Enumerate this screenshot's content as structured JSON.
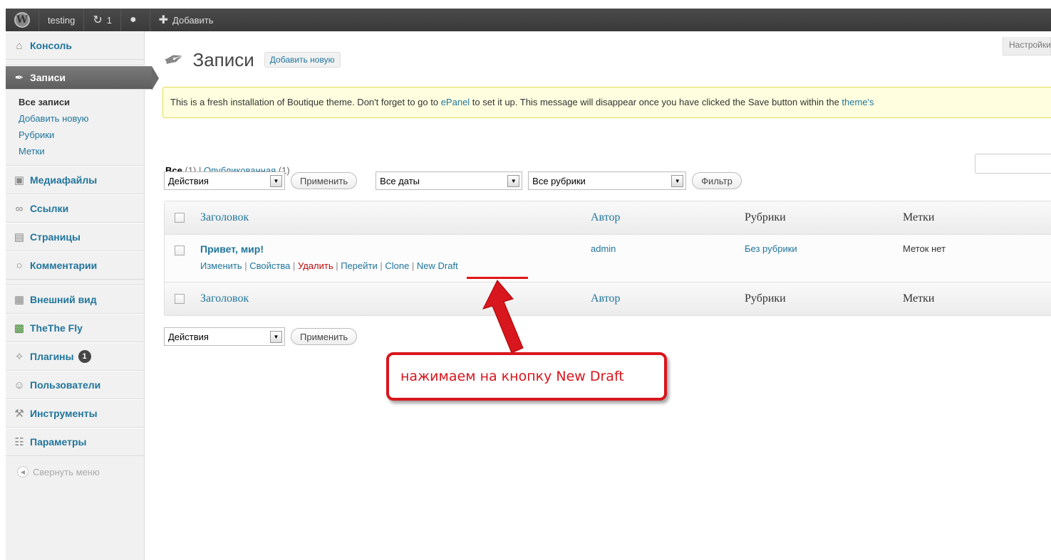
{
  "adminbar": {
    "logo": "W",
    "site": "testing",
    "updates_icon": "refresh-icon",
    "updates_count": "1",
    "comments_icon": "comment-bubble-icon",
    "add_icon": "plus-icon",
    "add_label": "Добавить"
  },
  "sidebar": {
    "items": [
      {
        "icon": "home-icon",
        "label": "Консоль"
      },
      {
        "icon": "pin-icon",
        "label": "Записи"
      },
      {
        "icon": "media-icon",
        "label": "Медиафайлы"
      },
      {
        "icon": "links-icon",
        "label": "Ссылки"
      },
      {
        "icon": "pages-icon",
        "label": "Страницы"
      },
      {
        "icon": "comments-icon",
        "label": "Комментарии"
      },
      {
        "icon": "appearance-icon",
        "label": "Внешний вид"
      },
      {
        "icon": "thethe-fly-icon",
        "label": "TheThe Fly"
      },
      {
        "icon": "plugins-icon",
        "label": "Плагины",
        "badge": "1"
      },
      {
        "icon": "users-icon",
        "label": "Пользователи"
      },
      {
        "icon": "tools-icon",
        "label": "Инструменты"
      },
      {
        "icon": "settings-icon",
        "label": "Параметры"
      }
    ],
    "submenu": [
      "Все записи",
      "Добавить новую",
      "Рубрики",
      "Метки"
    ],
    "collapse_label": "Свернуть меню"
  },
  "screen_options": "Настройки экрана",
  "page": {
    "title": "Записи",
    "add_new": "Добавить новую"
  },
  "notice": {
    "text_before": "This is a fresh installation of Boutique theme. Don't forget to go to ",
    "link": "ePanel",
    "text_after": " to set it up. This message will disappear once you have clicked the Save button within the ",
    "link2": "theme's"
  },
  "filters": {
    "all_label": "Все",
    "all_count": "(1)",
    "sep": "|",
    "published_label": "Опубликованная",
    "published_count": "(1)"
  },
  "tablenav_top": {
    "bulk_action": "Действия",
    "apply": "Применить",
    "dates": "Все даты",
    "cats": "Все рубрики",
    "filter": "Фильтр"
  },
  "table": {
    "columns": {
      "title": "Заголовок",
      "author": "Автор",
      "categories": "Рубрики",
      "tags": "Метки"
    },
    "rows": [
      {
        "title": "Привет, мир!",
        "actions": {
          "edit": "Изменить",
          "quick": "Свойства",
          "trash": "Удалить",
          "view": "Перейти",
          "clone": "Clone",
          "new_draft": "New Draft"
        },
        "author": "admin",
        "categories": "Без рубрики",
        "tags": "Меток нет"
      }
    ]
  },
  "tablenav_bottom": {
    "bulk_action": "Действия",
    "apply": "Применить"
  },
  "annotation": {
    "text": "нажимаем на кнопку New Draft",
    "color": "#d8161d"
  }
}
